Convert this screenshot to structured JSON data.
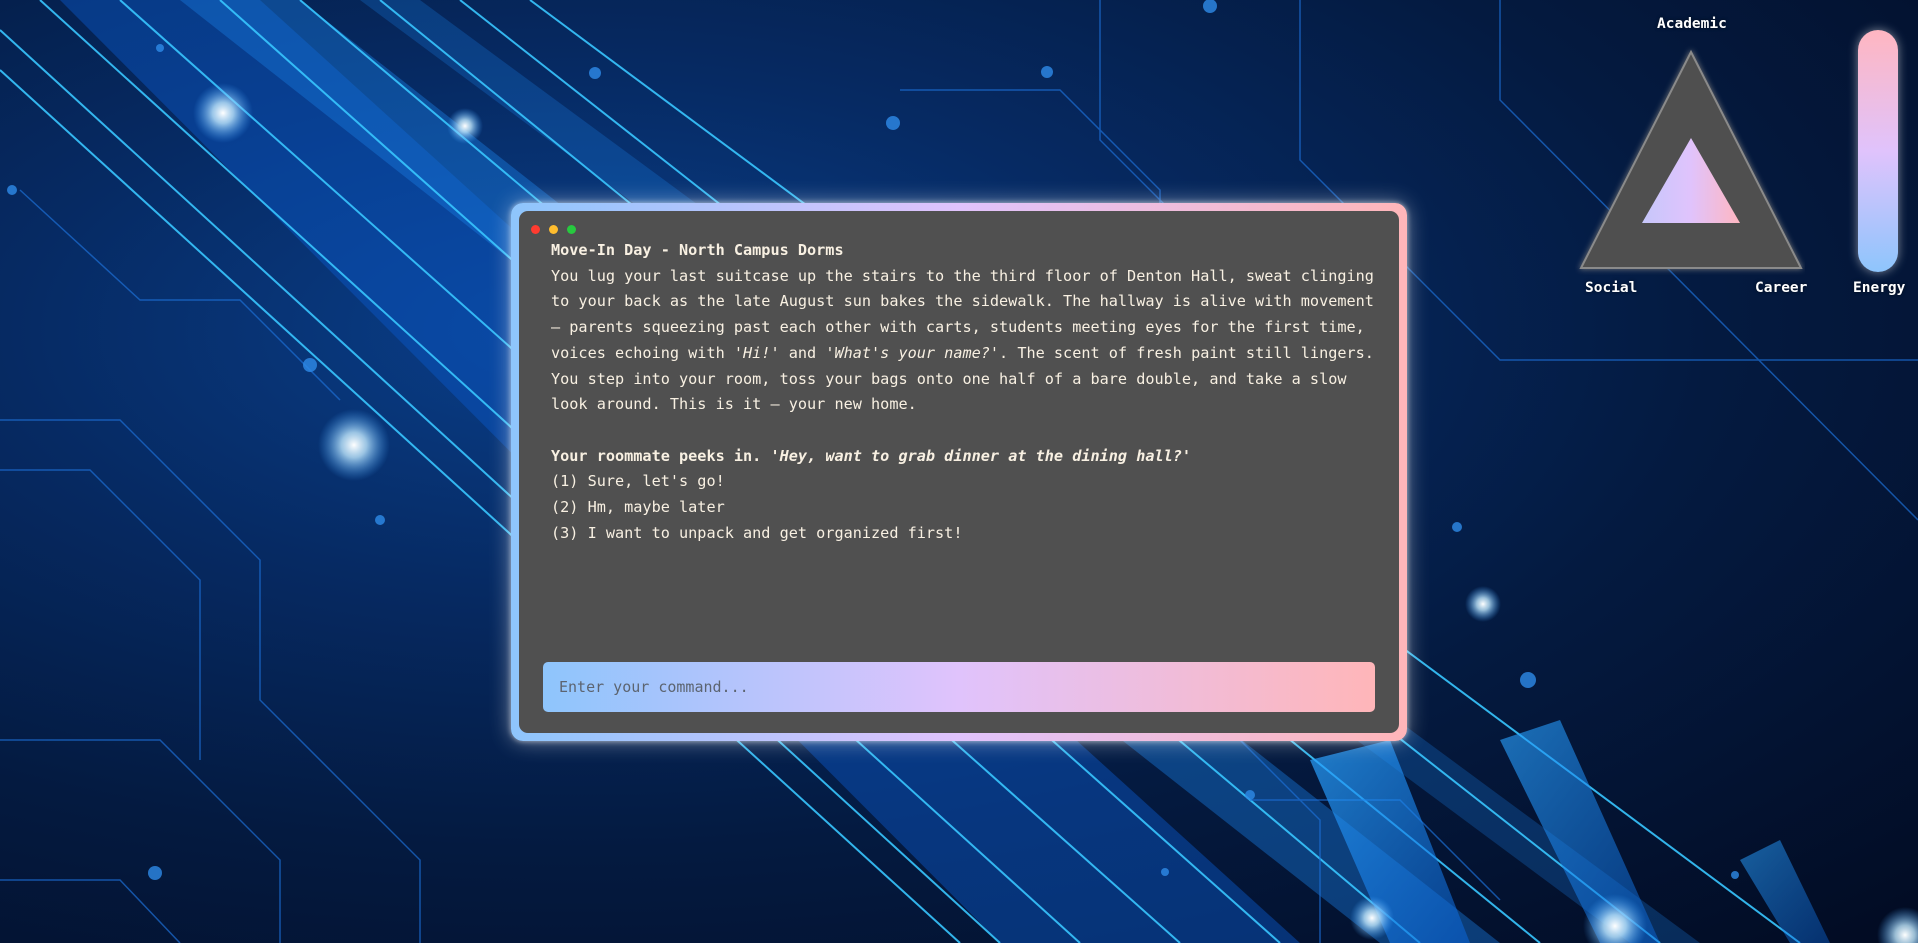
{
  "terminal": {
    "title": "Move-In Day - North Campus Dorms",
    "narrative": [
      {
        "text": "You lug your last suitcase up the stairs to the third floor of Denton Hall, sweat clinging to your back as the late August sun bakes the sidewalk. The hallway is alive with movement — parents squeezing past each other with carts, students meeting eyes for the first time, voices echoing with "
      },
      {
        "text": "'Hi!'",
        "italic": true
      },
      {
        "text": " and "
      },
      {
        "text": "'What's your name?'",
        "italic": true
      },
      {
        "text": ". The scent of fresh paint still lingers. You step into your room, toss your bags onto one half of a bare double, and take a slow look around. This is it — your new home."
      }
    ],
    "prompt_text": "Your roommate peeks in. ",
    "prompt_quote": "'Hey, want to grab dinner at the dining hall?'",
    "options": [
      "(1) Sure, let's go!",
      "(2) Hm, maybe later",
      "(3) I want to unpack and get organized first!"
    ],
    "input_placeholder": "Enter your command..."
  },
  "stats": {
    "academic_label": "Academic",
    "social_label": "Social",
    "career_label": "Career",
    "energy_label": "Energy",
    "triangle_fill_level": 0.5,
    "energy_level": 1.0
  },
  "colors": {
    "gradient": [
      "#8ec5fc",
      "#e0c3fc",
      "#ffb6b9"
    ],
    "terminal_bg": "#505050",
    "text": "#f8f0e2",
    "background": "#041a40"
  }
}
